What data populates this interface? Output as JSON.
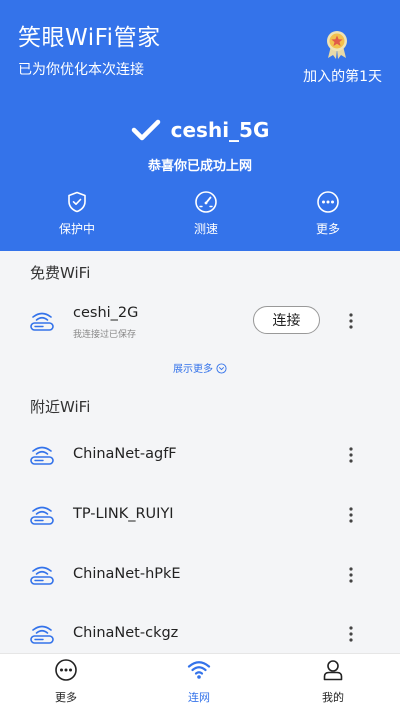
{
  "header": {
    "app_title": "笑眼WiFi管家",
    "subtitle": "已为你优化本次连接",
    "badge_text": "加入的第1天",
    "connected_ssid": "ceshi_5G",
    "congrats": "恭喜你已成功上网",
    "actions": [
      {
        "label": "保护中",
        "icon": "shield-check-icon"
      },
      {
        "label": "测速",
        "icon": "speedometer-icon"
      },
      {
        "label": "更多",
        "icon": "more-dots-icon"
      }
    ]
  },
  "free_wifi": {
    "title": "免费WiFi",
    "items": [
      {
        "name": "ceshi_2G",
        "status": "我连接过已保存",
        "button": "连接"
      }
    ],
    "show_more": "展示更多"
  },
  "nearby_wifi": {
    "title": "附近WiFi",
    "items": [
      {
        "name": "ChinaNet-agfF"
      },
      {
        "name": "TP-LINK_RUIYI"
      },
      {
        "name": "ChinaNet-hPkE"
      },
      {
        "name": "ChinaNet-ckgz"
      }
    ]
  },
  "bottom_nav": [
    {
      "label": "更多",
      "icon": "more-circle-icon",
      "active": false
    },
    {
      "label": "连网",
      "icon": "wifi-icon",
      "active": true
    },
    {
      "label": "我的",
      "icon": "person-icon",
      "active": false
    }
  ],
  "colors": {
    "primary": "#3473ea",
    "background": "#f4f5f7",
    "medal_gold": "#f2c14e"
  }
}
